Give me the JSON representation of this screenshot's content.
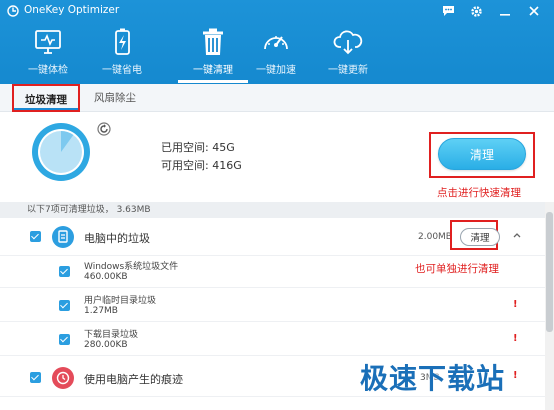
{
  "window": {
    "title": "OneKey Optimizer",
    "icons": [
      "chat-icon",
      "gear-icon",
      "minimize-icon",
      "close-icon"
    ]
  },
  "nav": {
    "items": [
      {
        "label": "一键体检",
        "icon": "monitor-check-icon"
      },
      {
        "label": "一键省电",
        "icon": "battery-icon"
      },
      {
        "label": "一键清理",
        "icon": "trash-icon",
        "active": true
      },
      {
        "label": "一键加速",
        "icon": "speedometer-icon"
      },
      {
        "label": "一键更新",
        "icon": "cloud-download-icon"
      }
    ]
  },
  "subtabs": {
    "items": [
      "垃圾清理",
      "风扇除尘"
    ],
    "active": 0
  },
  "summary": {
    "used_label": "已用空间: 45G",
    "free_label": "可用空间: 416G",
    "used_fraction": 0.1,
    "clean_button": "清理",
    "annotation": "点击进行快速清理"
  },
  "list": {
    "header": "以下7项可清理垃圾， 3.63MB",
    "categories": [
      {
        "label": "电脑中的垃圾",
        "size": "2.00MB",
        "clean_button": "清理",
        "annotation": "也可单独进行清理",
        "children": [
          {
            "name": "Windows系统垃圾文件",
            "size": "460.00KB"
          },
          {
            "name": "用户临时目录垃圾",
            "size": "1.27MB",
            "warning": "!"
          },
          {
            "name": "下载目录垃圾",
            "size": "280.00KB",
            "warning": "!"
          }
        ]
      },
      {
        "label": "使用电脑产生的痕迹",
        "size": "3MB",
        "warning": "!"
      }
    ]
  },
  "colors": {
    "header": "#1589cf",
    "accent": "#2b9ee0",
    "annotation": "#e02020"
  },
  "watermark": "极速下载站"
}
